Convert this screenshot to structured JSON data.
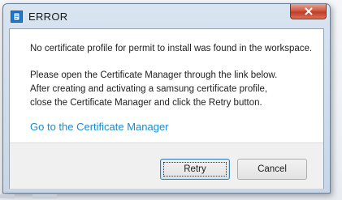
{
  "window": {
    "title": "ERROR",
    "close_icon": "close-icon",
    "app_icon": "dialog-app-icon"
  },
  "dialog": {
    "message_line1": "No certificate profile for permit to install was found in the workspace.",
    "message_line2": "Please open the Certificate Manager through the link below.",
    "message_line3": "After creating and activating a samsung certificate profile,",
    "message_line4": "close the Certificate Manager and click the Retry button.",
    "link_text": "Go to the Certificate Manager"
  },
  "buttons": {
    "retry_label": "Retry",
    "cancel_label": "Cancel"
  },
  "colors": {
    "link": "#1a8bd1",
    "close_button": "#c13d27",
    "default_button_border": "#3c7fb1"
  }
}
